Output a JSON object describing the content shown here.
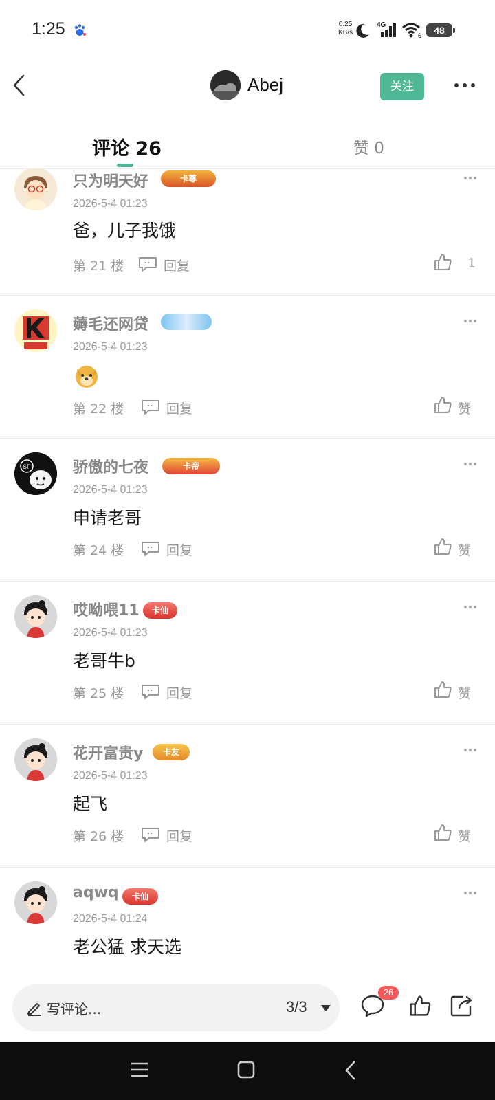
{
  "status": {
    "time": "1:25",
    "net_speed_value": "0.25",
    "net_speed_unit": "KB/s",
    "network": "4G",
    "wifi_sub": "6",
    "battery": "48"
  },
  "header": {
    "username": "Abej",
    "follow_label": "关注"
  },
  "tabs": {
    "comments": "评论 26",
    "likes": "赞 0"
  },
  "comments": [
    {
      "user": "只为明天好",
      "badge": "卡尊",
      "time": "2026-5-4 01:23",
      "text": "爸，儿子我饿",
      "floor": "第 21 楼",
      "reply": "回复",
      "likes": "1"
    },
    {
      "user": "薅毛还网贷",
      "badge": "",
      "time": "2026-5-4 01:23",
      "text": "",
      "floor": "第 22 楼",
      "reply": "回复",
      "likes": "赞"
    },
    {
      "user": "骄傲的七夜",
      "badge": "卡帝",
      "time": "2026-5-4 01:23",
      "text": "申请老哥",
      "floor": "第 24 楼",
      "reply": "回复",
      "likes": "赞"
    },
    {
      "user": "哎呦喂11",
      "badge": "卡仙",
      "time": "2026-5-4 01:23",
      "text": "老哥牛b",
      "floor": "第 25 楼",
      "reply": "回复",
      "likes": "赞"
    },
    {
      "user": "花开富贵y",
      "badge": "卡友",
      "time": "2026-5-4 01:23",
      "text": "起飞",
      "floor": "第 26 楼",
      "reply": "回复",
      "likes": "赞"
    },
    {
      "user": "aqwq",
      "badge": "卡仙",
      "time": "2026-5-4 01:24",
      "text": "老公猛 求天选"
    }
  ],
  "bottom": {
    "placeholder": "写评论...",
    "page": "3/3",
    "comment_count": "26"
  },
  "colors": {
    "accent": "#4fb796",
    "badge_red": "#e5484d",
    "count_red": "#f45a5a"
  }
}
